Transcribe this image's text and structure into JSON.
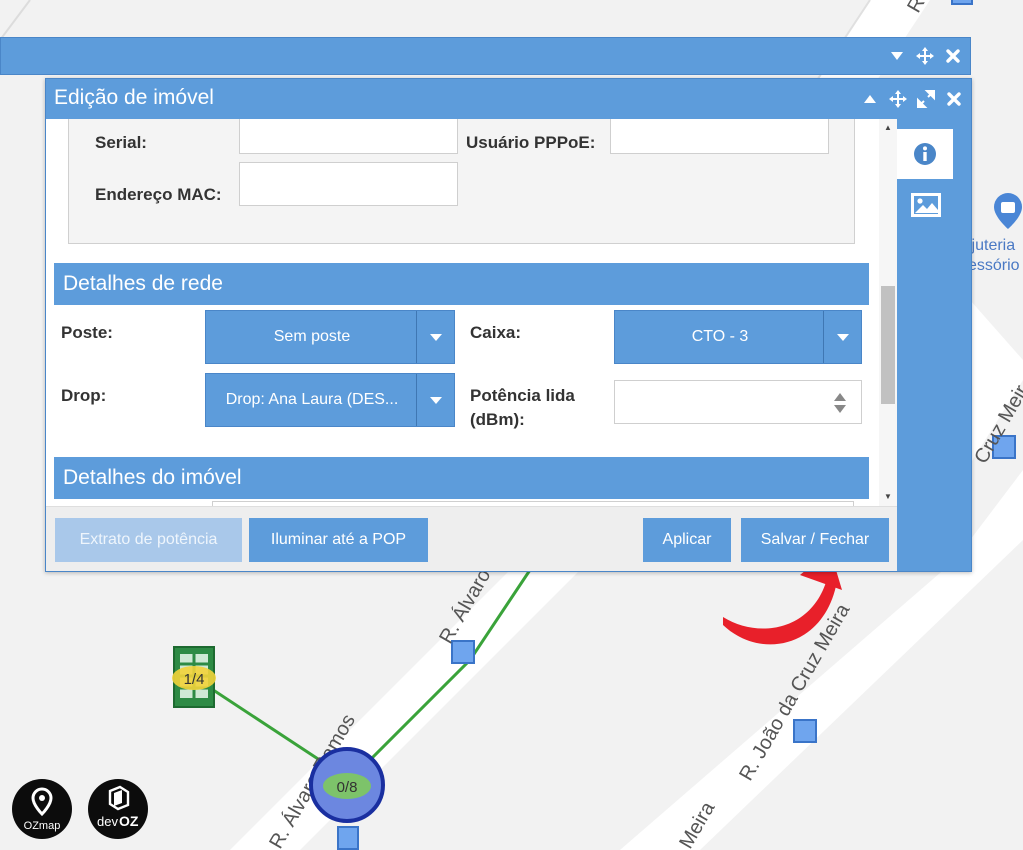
{
  "map": {
    "road_labels": [
      "R. Álvaro",
      "R. João da Cruz Meira",
      "Meira",
      "Cruz Meir",
      "R. Álvaro Ramos",
      "R."
    ],
    "poi_lines": [
      "ijuteria",
      "essório"
    ],
    "building_badge": "1/4",
    "cto_badge": "0/8",
    "logos": {
      "ozmap": "OZmap",
      "devoz_prefix": "dev",
      "devoz_suffix": "OZ"
    }
  },
  "outer_window": {
    "icons": [
      "chevron-down-icon",
      "move-icon",
      "close-icon"
    ]
  },
  "dialog": {
    "title": "Edição de imóvel",
    "header_icons": [
      "chevron-up-icon",
      "move-icon",
      "expand-icon",
      "close-icon"
    ],
    "fields": {
      "serial_label": "Serial:",
      "serial_value": "",
      "pppoe_label": "Usuário PPPoE:",
      "pppoe_value": "",
      "mac_label": "Endereço MAC:",
      "mac_value": ""
    },
    "network": {
      "title": "Detalhes de rede",
      "poste_label": "Poste:",
      "poste_value": "Sem poste",
      "caixa_label": "Caixa:",
      "caixa_value": "CTO - 3",
      "drop_label": "Drop:",
      "drop_value": "Drop: Ana Laura (DES...",
      "potencia_label_line1": "Potência lida",
      "potencia_label_line2": "(dBm):",
      "potencia_value": ""
    },
    "property": {
      "title": "Detalhes do imóvel"
    },
    "side_tabs": [
      "info-icon",
      "image-icon"
    ],
    "buttons": {
      "extrato": "Extrato de potência",
      "iluminar": "Iluminar até a POP",
      "aplicar": "Aplicar",
      "salvar": "Salvar / Fechar"
    }
  },
  "colors": {
    "accent": "#5d9cdb",
    "annotation_arrow": "#e8202a",
    "route": "#3aa33a"
  }
}
